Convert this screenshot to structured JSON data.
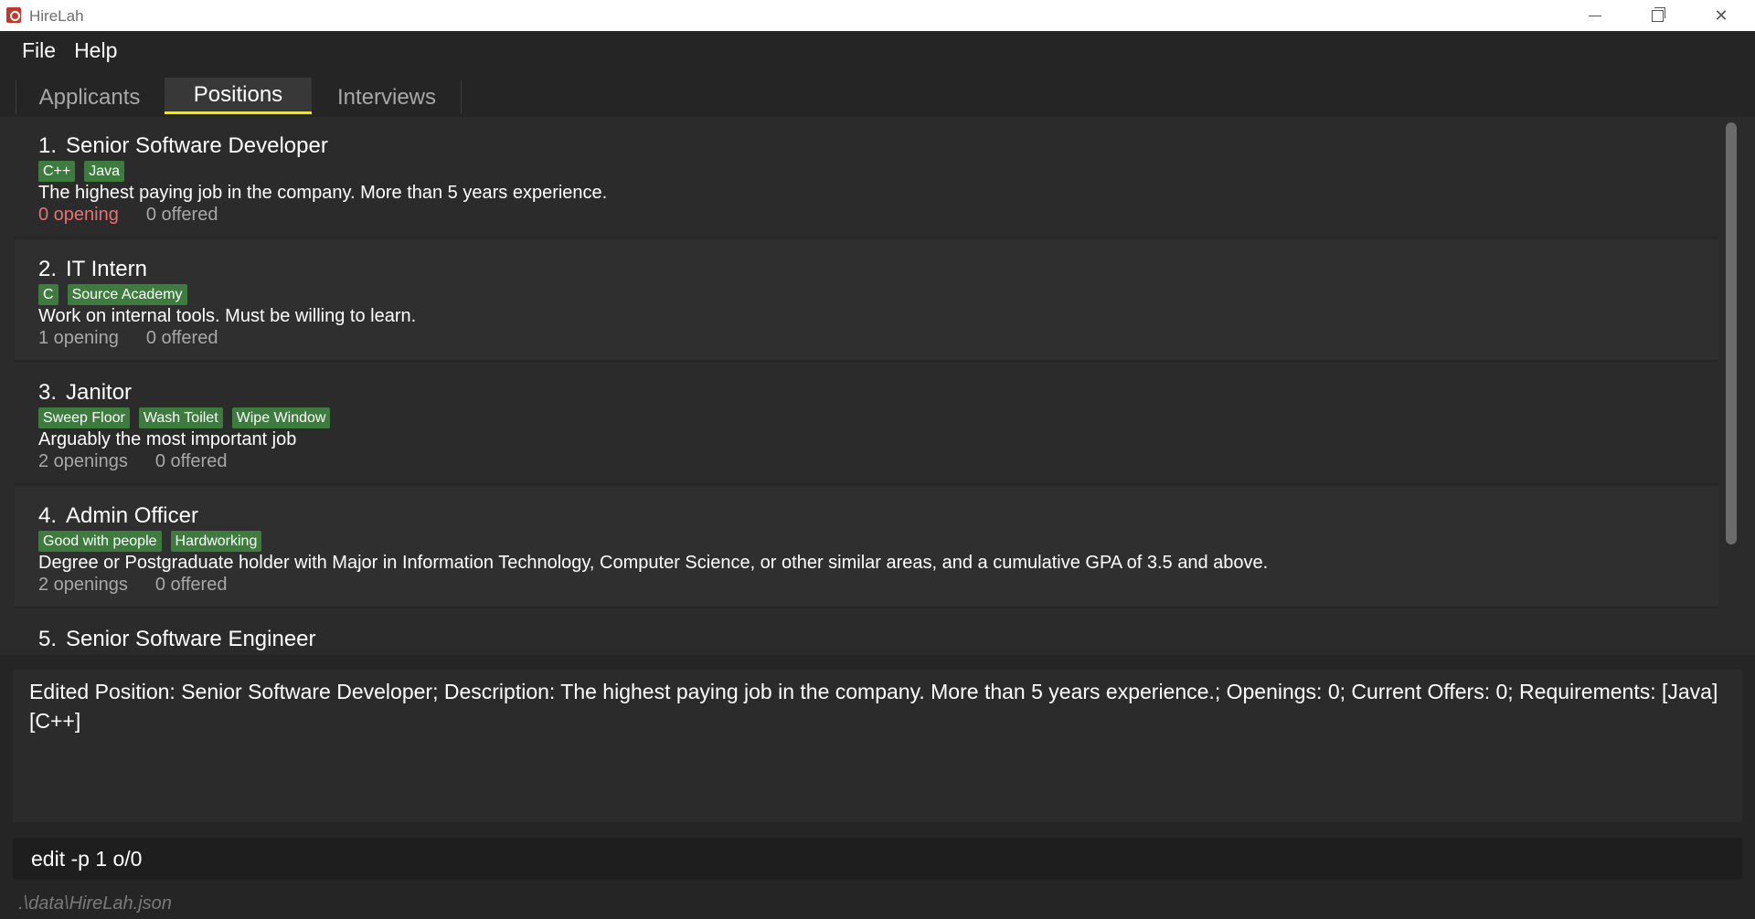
{
  "window": {
    "title": "HireLah"
  },
  "menu": {
    "items": [
      "File",
      "Help"
    ]
  },
  "tabs": [
    {
      "label": "Applicants",
      "active": false
    },
    {
      "label": "Positions",
      "active": true
    },
    {
      "label": "Interviews",
      "active": false
    }
  ],
  "positions": [
    {
      "index": "1.",
      "title": "Senior Software Developer",
      "tags": [
        "C++",
        "Java"
      ],
      "description": "The highest paying job in the company. More than 5 years experience.",
      "openings": "0 opening",
      "offered": "0 offered",
      "openings_zero": true
    },
    {
      "index": "2.",
      "title": "IT Intern",
      "tags": [
        "C",
        "Source Academy"
      ],
      "description": "Work on internal tools. Must be willing to learn.",
      "openings": "1 opening",
      "offered": "0 offered",
      "openings_zero": false
    },
    {
      "index": "3.",
      "title": "Janitor",
      "tags": [
        "Sweep Floor",
        "Wash Toilet",
        "Wipe Window"
      ],
      "description": "Arguably the most important job",
      "openings": "2 openings",
      "offered": "0 offered",
      "openings_zero": false
    },
    {
      "index": "4.",
      "title": "Admin Officer",
      "tags": [
        "Good with people",
        "Hardworking"
      ],
      "description": "Degree or Postgraduate holder with Major in Information Technology, Computer Science, or other similar areas, and a cumulative GPA of 3.5 and above.",
      "openings": "2 openings",
      "offered": "0 offered",
      "openings_zero": false
    },
    {
      "index": "5.",
      "title": "Senior Software Engineer",
      "tags": [],
      "description": "",
      "openings": "",
      "offered": "",
      "openings_zero": false
    }
  ],
  "result": {
    "text": "Edited Position: Senior Software Developer; Description: The highest paying job in the company. More than 5 years experience.; Openings: 0; Current Offers: 0; Requirements: [Java][C++]"
  },
  "command": {
    "value": "edit -p 1 o/0"
  },
  "status": {
    "path": ".\\data\\HireLah.json"
  },
  "colors": {
    "tag_bg": "#3e7b3e",
    "tab_underline": "#e8e24e",
    "zero_openings": "#e57373"
  }
}
